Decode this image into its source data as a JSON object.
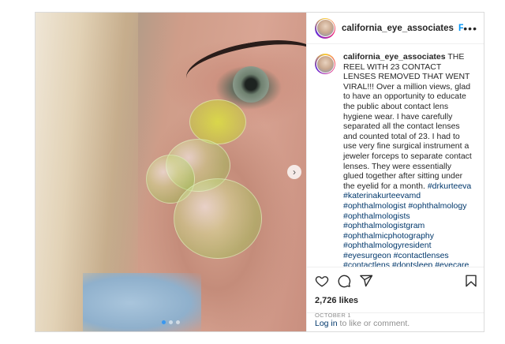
{
  "post": {
    "username": "california_eye_associates",
    "follow_label": "Follow",
    "more_label": "•••",
    "caption": {
      "username": "california_eye_associates",
      "text": "THE REEL WITH 23 CONTACT LENSES REMOVED THAT WENT VIRAL!!! Over a million views, glad to have an opportunity to educate the public about contact lens hygiene wear. I have carefully separated all the contact lenses and counted total of 23. I had to use very fine surgical instrument a jeweler forceps to separate contact lenses. They were essentially glued together after sitting under the eyelid for a month.",
      "hashtags": [
        "#drkurteeva",
        "#katerinakurteevamd",
        "#ophthalmologist",
        "#ophthalmology",
        "#ophthalmologists",
        "#ophthalmologistgram",
        "#ophthalmicphotography",
        "#ophthalmologyresident",
        "#eyesurgeon",
        "#contactlenses",
        "#contactlens",
        "#dontsleep",
        "#eyecare"
      ]
    },
    "likes": "2,726 likes",
    "date": "OCTOBER 1",
    "login_link": "Log in",
    "login_suffix": " to like or comment."
  },
  "carousel": {
    "next_icon": "chevron-right-icon",
    "slide_count": 3,
    "active_index": 0
  },
  "icons": {
    "like": "heart-icon",
    "comment": "comment-icon",
    "share": "share-icon",
    "save": "bookmark-icon"
  },
  "colors": {
    "link": "#0095f6",
    "hashtag": "#00376b",
    "muted": "#8e8e8e",
    "text": "#262626",
    "border": "#dbdbdb"
  }
}
